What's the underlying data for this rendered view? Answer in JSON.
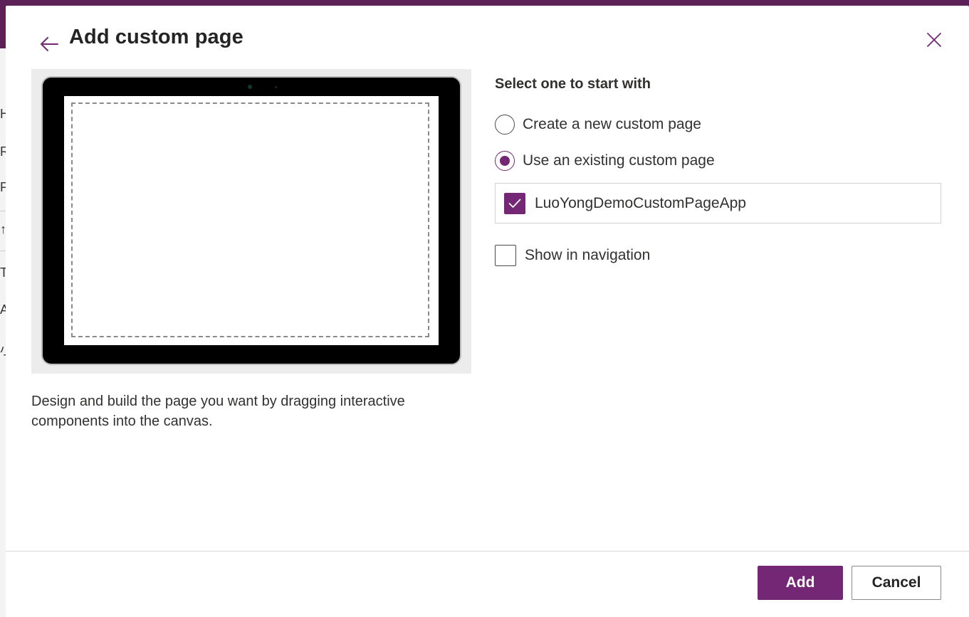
{
  "background": {
    "header_color": "#5c2157",
    "fragments": [
      "H",
      "Re",
      "Pi",
      "↑",
      "Te",
      "A",
      "小"
    ]
  },
  "dialog": {
    "title": "Add custom page",
    "back_icon": "arrow-left-icon",
    "close_icon": "close-icon",
    "accent_color": "#742774",
    "preview": {
      "description": "Design and build the page you want by dragging interactive components into the canvas."
    },
    "options": {
      "heading": "Select one to start with",
      "radios": [
        {
          "label": "Create a new custom page",
          "selected": false
        },
        {
          "label": "Use an existing custom page",
          "selected": true
        }
      ],
      "existing_page": {
        "label": "LuoYongDemoCustomPageApp",
        "checked": true
      },
      "show_in_navigation": {
        "label": "Show in navigation",
        "checked": false
      }
    },
    "footer": {
      "add_label": "Add",
      "cancel_label": "Cancel"
    }
  }
}
